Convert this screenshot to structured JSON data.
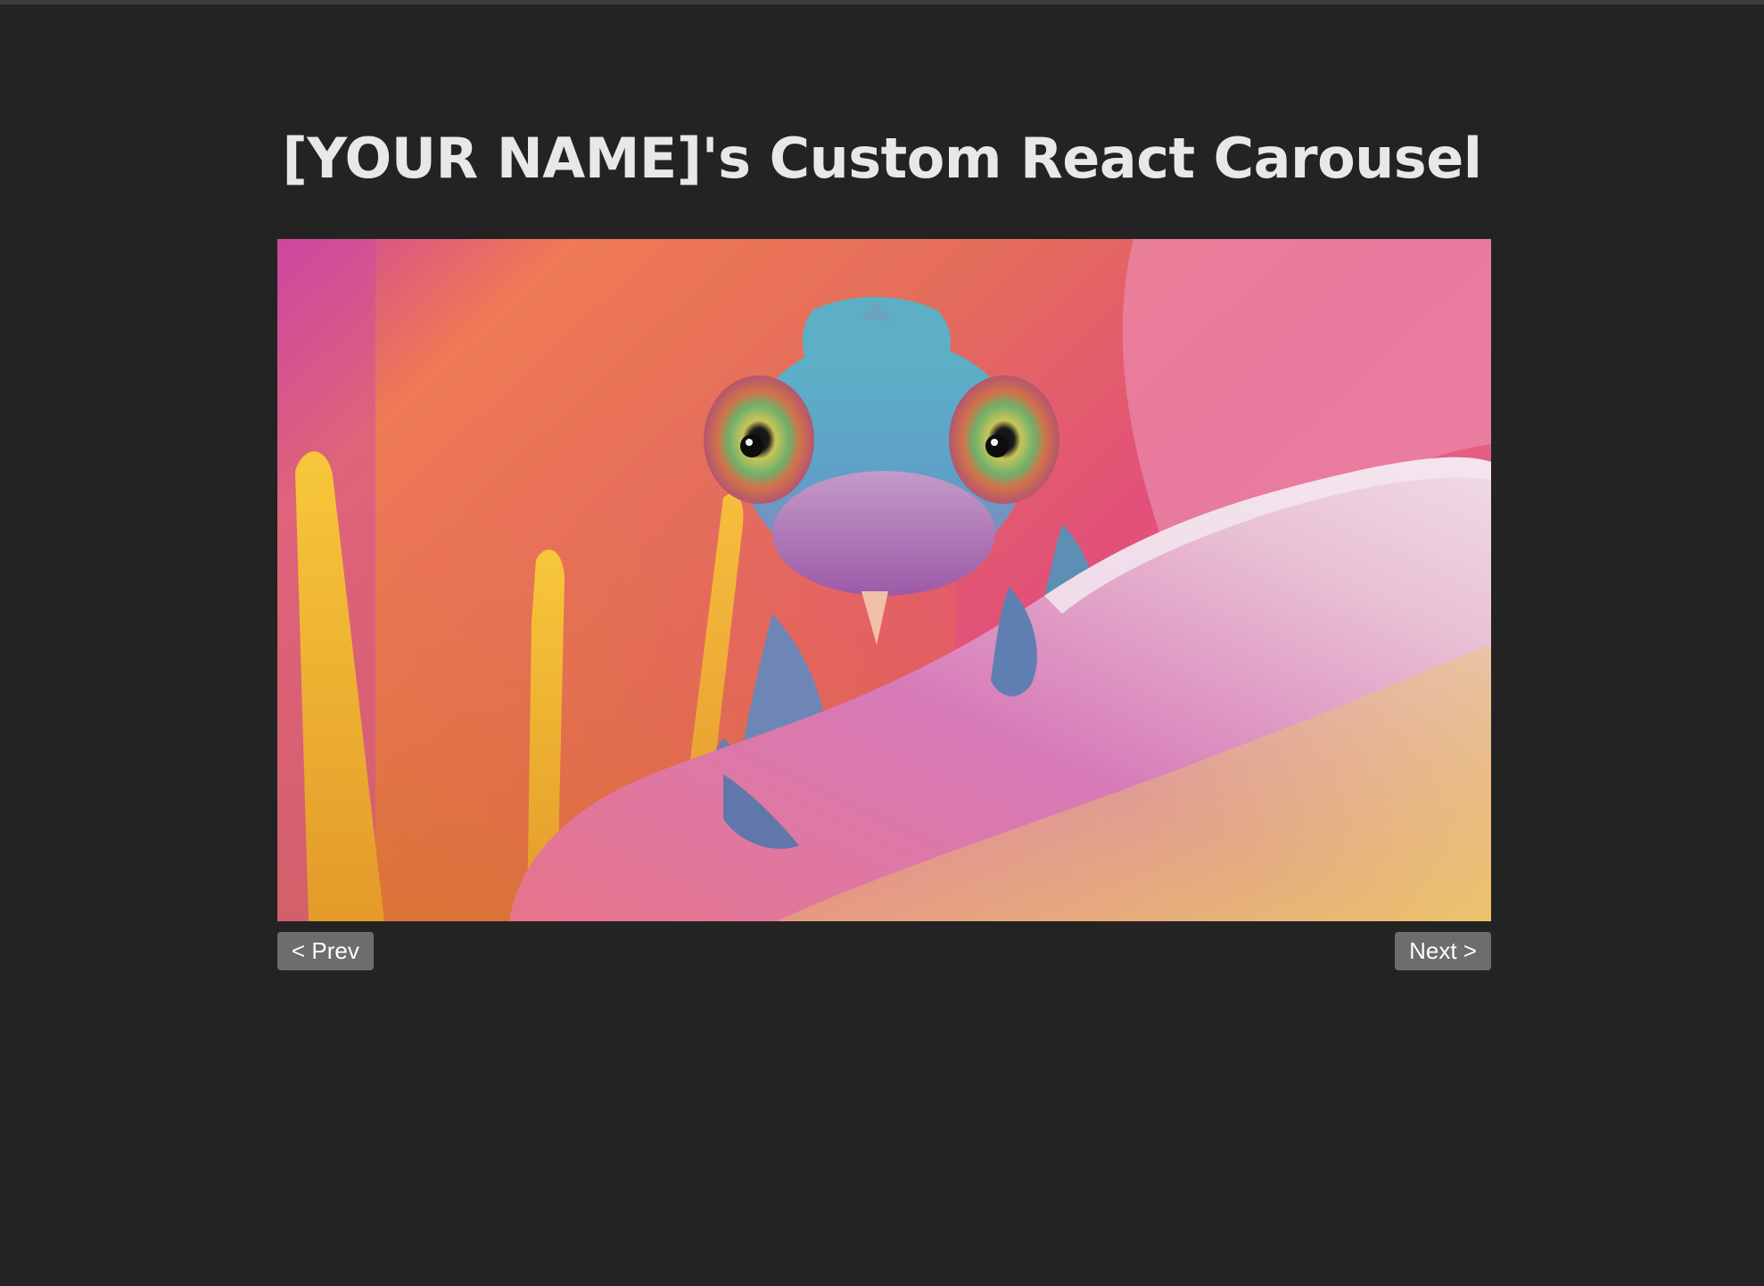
{
  "page": {
    "title": "[YOUR NAME]'s Custom React Carousel",
    "background_color": "#232323"
  },
  "carousel": {
    "slide_image": "chameleon-on-flower-photo",
    "prev_label": "< Prev",
    "next_label": "Next >",
    "button_color": "#6d6d6d"
  }
}
